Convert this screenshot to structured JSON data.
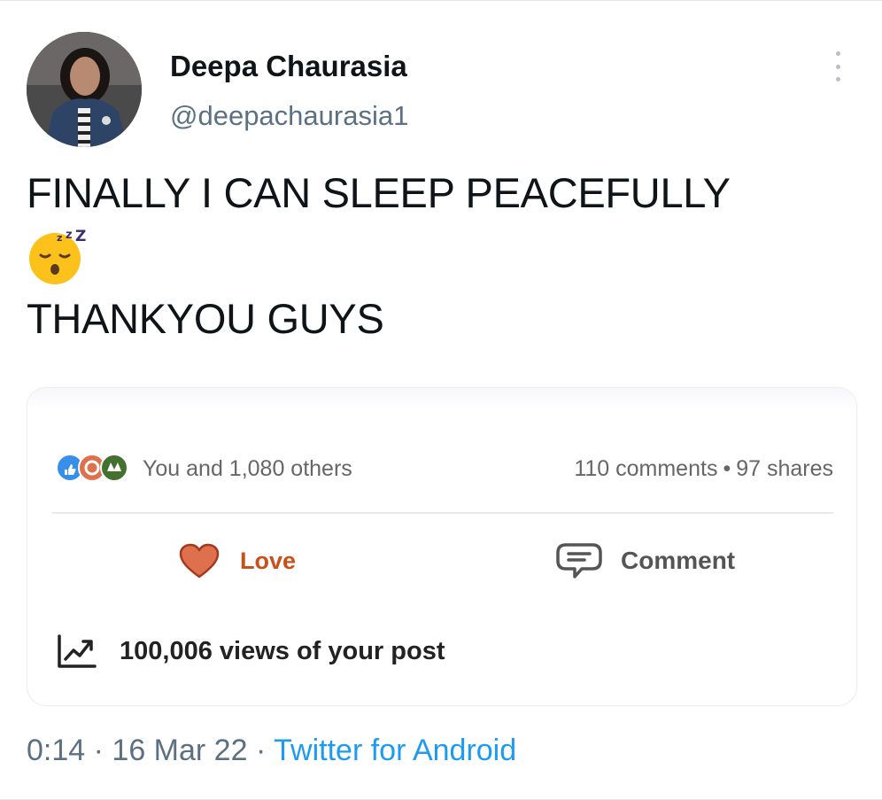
{
  "author": {
    "name": "Deepa Chaurasia",
    "handle": "@deepachaurasia1"
  },
  "tweet": {
    "line1": "FINALLY I CAN SLEEP PEACEFULLY",
    "emoji": "sleeping-face",
    "line3": "THANKYOU GUYS"
  },
  "card": {
    "reactors": "You and 1,080 others",
    "comments": "110 comments",
    "separator": "•",
    "shares": "97 shares",
    "love_label": "Love",
    "comment_label": "Comment",
    "views": "100,006 views of your post"
  },
  "meta": {
    "time": "0:14",
    "sep1": "·",
    "date": "16 Mar 22",
    "sep2": "·",
    "source": "Twitter for Android"
  },
  "colors": {
    "link": "#1d9bf0",
    "secondary_text": "#5b7083",
    "love": "#c9501a",
    "like_blue": "#378fe9",
    "celebrate_green": "#44712e"
  }
}
